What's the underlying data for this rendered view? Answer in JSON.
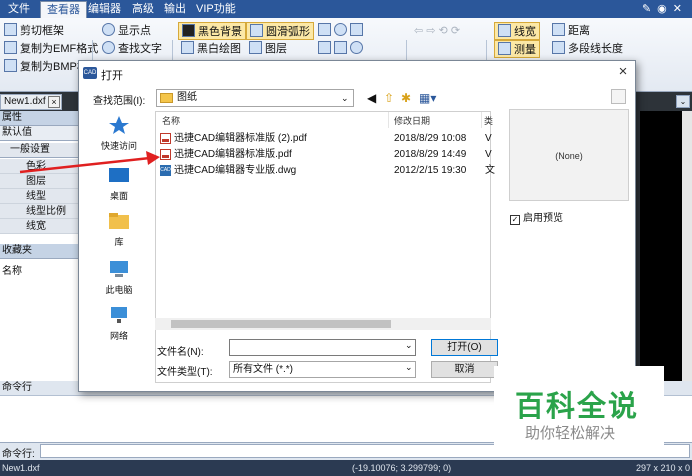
{
  "menubar": {
    "items": [
      "文件",
      "查看器",
      "编辑器",
      "高级",
      "输出",
      "VIP功能"
    ],
    "active_index": 1,
    "right_icons": [
      "help-icon",
      "settings-icon",
      "close-icon"
    ]
  },
  "ribbon": {
    "group1": [
      "剪切框架",
      "复制为EMF格式",
      "复制为BMP格"
    ],
    "group2": [
      "显示点",
      "查找文字"
    ],
    "group3": [
      "黑色背景",
      "黑白绘图",
      "圆滑弧形",
      "图层"
    ],
    "group4": [
      "线宽",
      "测量",
      "距离",
      "多段线长度"
    ]
  },
  "doc_tab": {
    "label": "New1.dxf",
    "close": "×"
  },
  "left_panel": {
    "header": "属性",
    "default_label": "默认值",
    "section": "一般设置",
    "rows": [
      "色彩",
      "图层",
      "线型",
      "线型比例",
      "线宽"
    ],
    "favorites_header": "收藏夹",
    "favorites_col": "名称"
  },
  "command": {
    "header": "命令行",
    "input_label": "命令行:"
  },
  "statusbar": {
    "file": "New1.dxf",
    "coords": "(-19.10076; 3.299799; 0)",
    "size": "297 x 210 x 0"
  },
  "dialog": {
    "title": "打开",
    "icon_text": "CAD",
    "close": "×",
    "lookin_label": "查找范围(I):",
    "lookin_value": "图纸",
    "places": [
      "快速访问",
      "桌面",
      "库",
      "此电脑",
      "网络"
    ],
    "columns": {
      "name": "名称",
      "date": "修改日期",
      "type": "类"
    },
    "files": [
      {
        "name": "迅捷CAD编辑器标准版 (2).pdf",
        "date": "2018/8/29 10:08",
        "type": "V",
        "kind": "pdf"
      },
      {
        "name": "迅捷CAD编辑器标准版.pdf",
        "date": "2018/8/29 14:49",
        "type": "V",
        "kind": "pdf"
      },
      {
        "name": "迅捷CAD编辑器专业版.dwg",
        "date": "2012/2/15 19:30",
        "type": "文",
        "kind": "dwg"
      }
    ],
    "filename_label": "文件名(N):",
    "filename_value": "",
    "filetype_label": "文件类型(T):",
    "filetype_value": "所有文件 (*.*)",
    "open_button": "打开(O)",
    "cancel_button": "取消",
    "preview_text": "(None)",
    "preview_checkbox": "启用预览",
    "preview_checked": "✓"
  },
  "watermark": {
    "title": "百科全说",
    "subtitle": "助你轻松解决"
  },
  "colors": {
    "accent": "#2b579a",
    "watermark_green": "#2aa34a",
    "arrow_red": "#e02020"
  }
}
